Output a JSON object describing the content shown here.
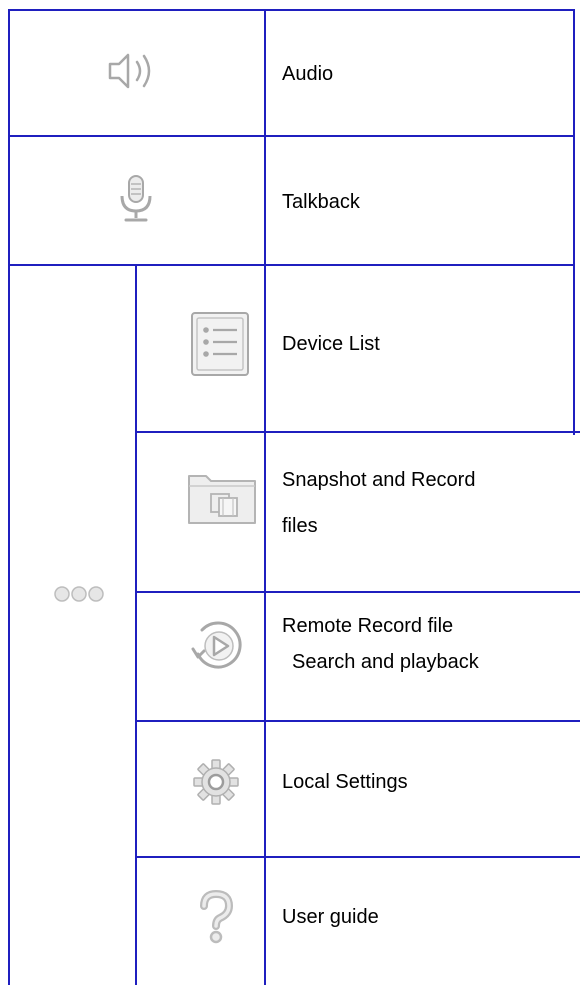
{
  "rows": [
    {
      "label": "Audio",
      "icon": "speaker-icon"
    },
    {
      "label": "Talkback",
      "icon": "microphone-icon"
    }
  ],
  "more": {
    "icon": "more-dots-icon",
    "items": [
      {
        "label": "Device List",
        "icon": "list-icon"
      },
      {
        "label_lines": [
          "Snapshot and Record",
          "files"
        ],
        "icon": "folder-film-icon"
      },
      {
        "label_lines": [
          "Remote Record file",
          "Search and playback"
        ],
        "icon": "replay-icon"
      },
      {
        "label": "Local Settings",
        "icon": "gear-icon"
      },
      {
        "label": "User guide",
        "icon": "question-icon"
      }
    ]
  },
  "colors": {
    "border": "#1f1fbf",
    "icon_gray": "#a8a8a8",
    "icon_light": "#e6e6e6"
  }
}
